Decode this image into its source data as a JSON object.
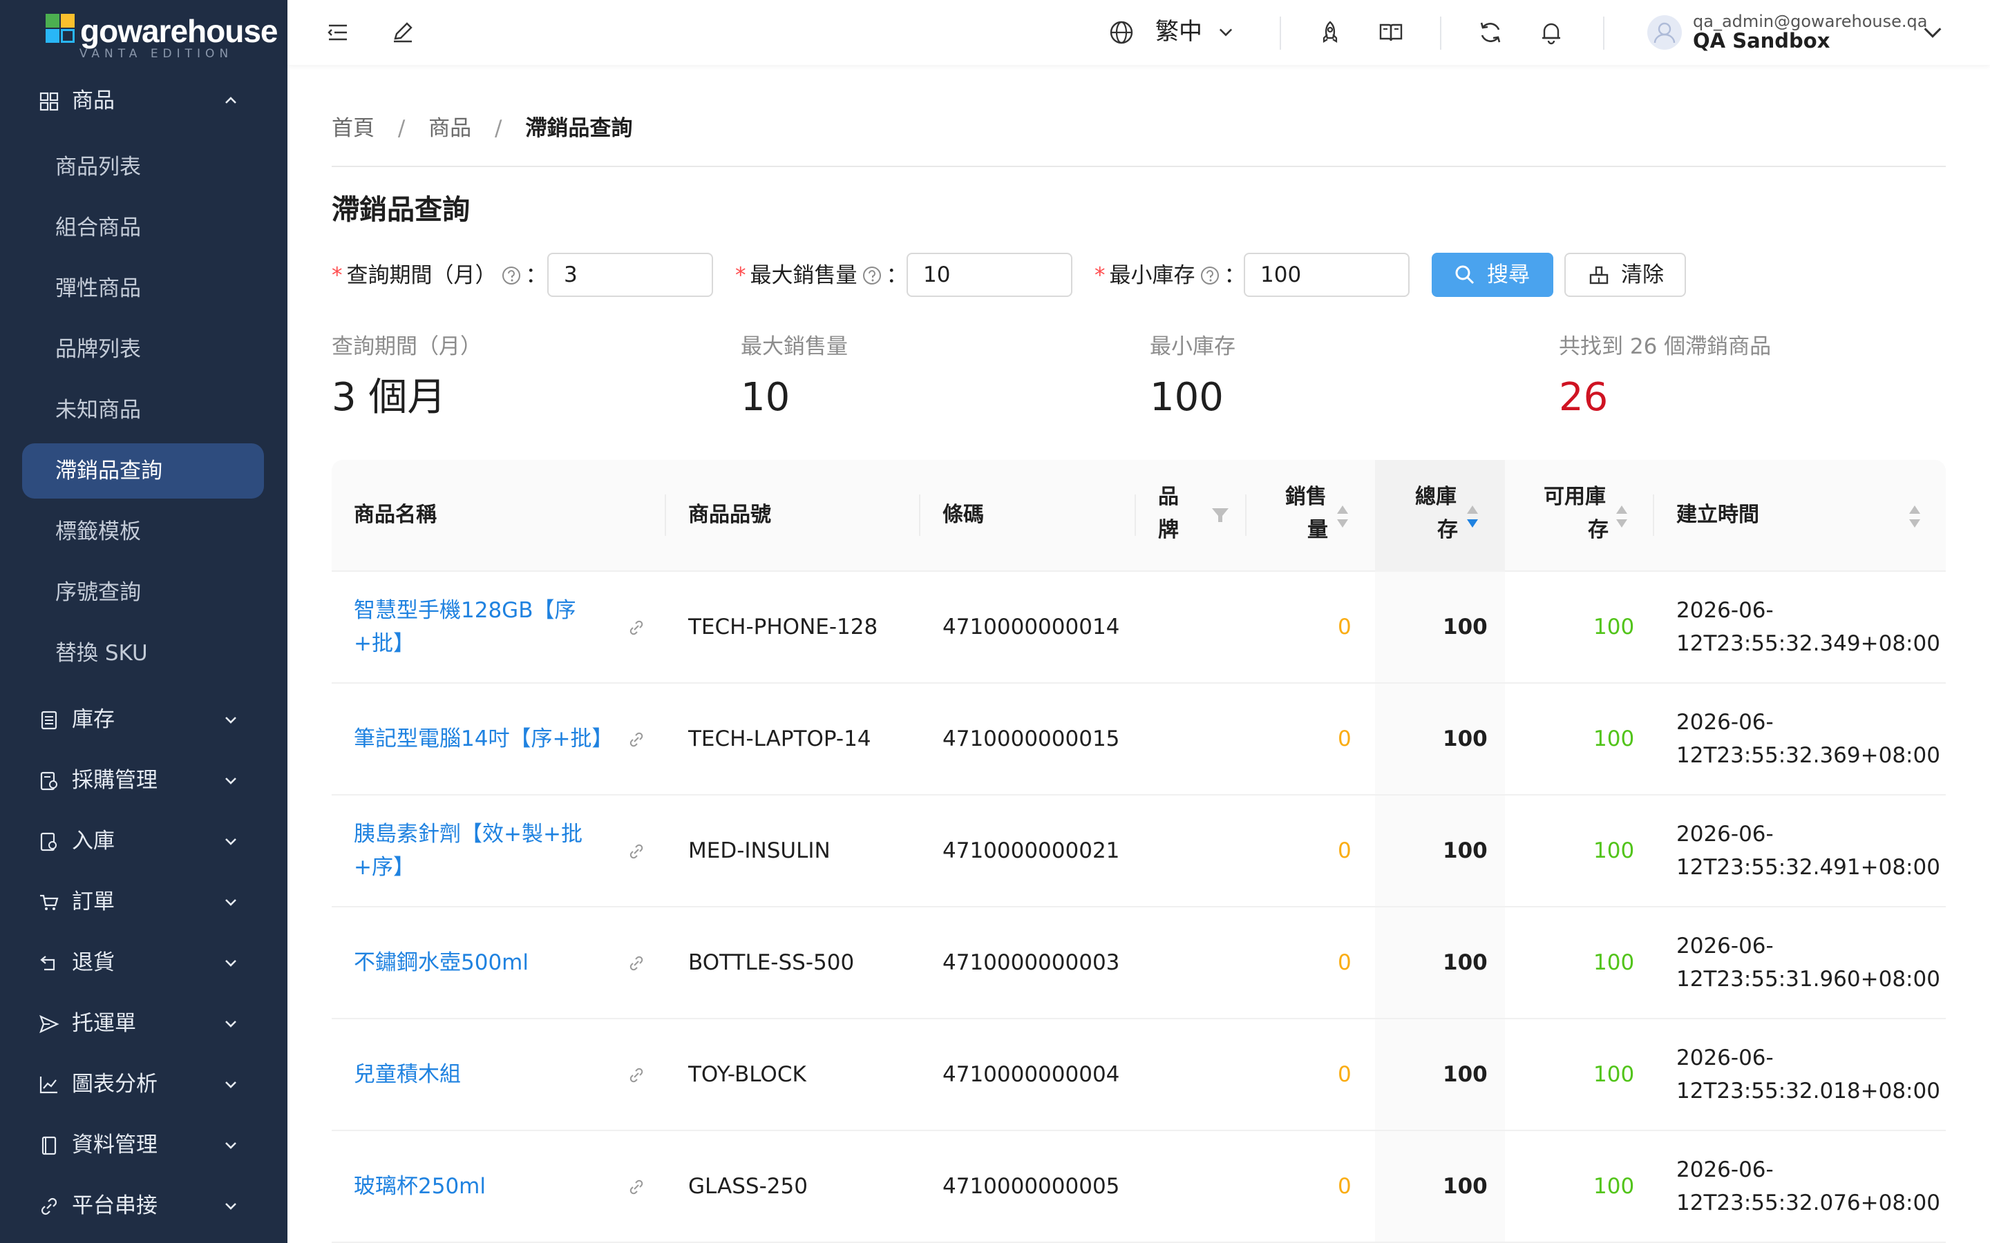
{
  "brand": {
    "name": "gowarehouse",
    "edition": "VANTA EDITION"
  },
  "sidebar": {
    "product_group": "商品",
    "product_items": [
      {
        "label": "商品列表"
      },
      {
        "label": "組合商品"
      },
      {
        "label": "彈性商品"
      },
      {
        "label": "品牌列表"
      },
      {
        "label": "未知商品"
      },
      {
        "label": "滯銷品查詢"
      },
      {
        "label": "標籤模板"
      },
      {
        "label": "序號查詢"
      },
      {
        "label": "替換 SKU"
      }
    ],
    "groups": [
      {
        "label": "庫存",
        "icon": "inventory-icon"
      },
      {
        "label": "採購管理",
        "icon": "purchase-icon"
      },
      {
        "label": "入庫",
        "icon": "inbound-icon"
      },
      {
        "label": "訂單",
        "icon": "cart-icon"
      },
      {
        "label": "退貨",
        "icon": "return-icon"
      },
      {
        "label": "托運單",
        "icon": "send-icon"
      },
      {
        "label": "圖表分析",
        "icon": "chart-icon"
      },
      {
        "label": "資料管理",
        "icon": "book-icon"
      },
      {
        "label": "平台串接",
        "icon": "link-icon"
      }
    ]
  },
  "header": {
    "language": "繁中",
    "user_email": "qa_admin@gowarehouse.qa",
    "org": "QA Sandbox"
  },
  "breadcrumb": {
    "home": "首頁",
    "section": "商品",
    "current": "滯銷品查詢"
  },
  "page_title": "滯銷品查詢",
  "form": {
    "period_label": "查詢期間（月）",
    "period_value": "3",
    "max_sales_label": "最大銷售量",
    "max_sales_value": "10",
    "min_stock_label": "最小庫存",
    "min_stock_value": "100",
    "colon": "：",
    "search_label": "搜尋",
    "clear_label": "清除"
  },
  "stats": [
    {
      "label": "查詢期間（月）",
      "value": "3 個月"
    },
    {
      "label": "最大銷售量",
      "value": "10"
    },
    {
      "label": "最小庫存",
      "value": "100"
    },
    {
      "label": "共找到 26 個滯銷商品",
      "value": "26"
    }
  ],
  "table": {
    "columns": {
      "name": "商品名稱",
      "sku": "商品品號",
      "barcode": "條碼",
      "brand_1": "品",
      "brand_2": "牌",
      "sales_1": "銷售",
      "sales_2": "量",
      "total_1": "總庫",
      "total_2": "存",
      "avail_1": "可用庫",
      "avail_2": "存",
      "created": "建立時間"
    },
    "rows": [
      {
        "name_1": "智慧型手機128GB【序",
        "name_2": "+批】",
        "sku": "TECH-PHONE-128",
        "barcode": "4710000000014",
        "sales": "0",
        "total": "100",
        "available": "100",
        "created_1": "2026-06-",
        "created_2": "12T23:55:32.349+08:00"
      },
      {
        "name_1": "筆記型電腦14吋【序+批】",
        "name_2": "",
        "sku": "TECH-LAPTOP-14",
        "barcode": "4710000000015",
        "sales": "0",
        "total": "100",
        "available": "100",
        "created_1": "2026-06-",
        "created_2": "12T23:55:32.369+08:00"
      },
      {
        "name_1": "胰島素針劑【效+製+批",
        "name_2": "+序】",
        "sku": "MED-INSULIN",
        "barcode": "4710000000021",
        "sales": "0",
        "total": "100",
        "available": "100",
        "created_1": "2026-06-",
        "created_2": "12T23:55:32.491+08:00"
      },
      {
        "name_1": "不鏽鋼水壺500ml",
        "name_2": "",
        "sku": "BOTTLE-SS-500",
        "barcode": "4710000000003",
        "sales": "0",
        "total": "100",
        "available": "100",
        "created_1": "2026-06-",
        "created_2": "12T23:55:31.960+08:00"
      },
      {
        "name_1": "兒童積木組",
        "name_2": "",
        "sku": "TOY-BLOCK",
        "barcode": "4710000000004",
        "sales": "0",
        "total": "100",
        "available": "100",
        "created_1": "2026-06-",
        "created_2": "12T23:55:32.018+08:00"
      },
      {
        "name_1": "玻璃杯250ml",
        "name_2": "",
        "sku": "GLASS-250",
        "barcode": "4710000000005",
        "sales": "0",
        "total": "100",
        "available": "100",
        "created_1": "2026-06-",
        "created_2": "12T23:55:32.076+08:00"
      }
    ]
  },
  "colors": {
    "sidebar_bg": "#1f2d44",
    "active_item": "#2e4c7e",
    "link": "#1f82e0",
    "primary_button": "#4aa3ee",
    "sales_zero": "#faad14",
    "available": "#52c41a",
    "count_red": "#cf1322"
  }
}
